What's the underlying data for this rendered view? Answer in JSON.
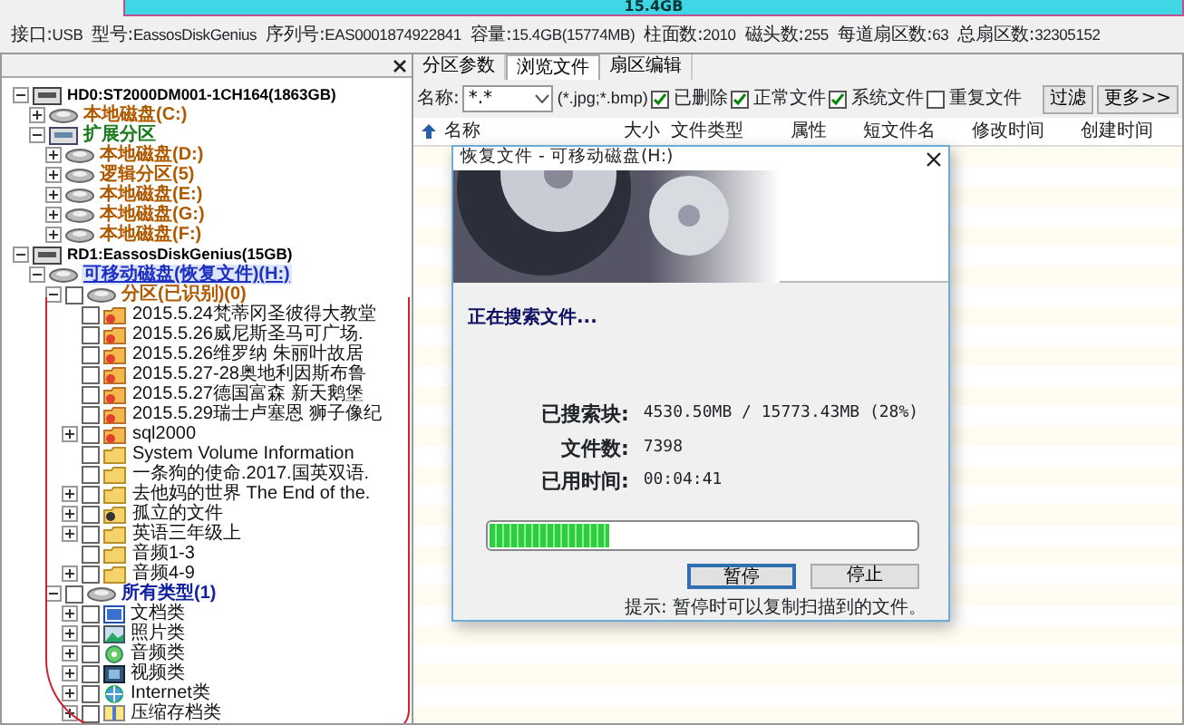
{
  "capacity_bar": {
    "label": "15.4GB"
  },
  "disk_info": [
    {
      "label": "接口:",
      "value": "USB"
    },
    {
      "label": "型号:",
      "value": "EassosDiskGenius"
    },
    {
      "label": "序列号:",
      "value": "EAS0001874922841"
    },
    {
      "label": "容量:",
      "value": "15.4GB(15774MB)"
    },
    {
      "label": "柱面数:",
      "value": "2010"
    },
    {
      "label": "磁头数:",
      "value": "255"
    },
    {
      "label": "每道扇区数:",
      "value": "63"
    },
    {
      "label": "总扇区数:",
      "value": "32305152"
    }
  ],
  "tree": [
    {
      "label": "HD0:ST2000DM001-1CH164(1863GB)",
      "kind": "drive",
      "expanded": true,
      "selected": false,
      "children": [
        {
          "label": "本地磁盘(C:)",
          "kind": "volume",
          "expanded": false,
          "selected": false
        },
        {
          "label": "扩展分区",
          "kind": "extended",
          "expanded": true,
          "selected": false,
          "children": [
            {
              "label": "本地磁盘(D:)",
              "kind": "volume",
              "expanded": false,
              "selected": false
            },
            {
              "label": "逻辑分区(5)",
              "kind": "volume",
              "expanded": false,
              "selected": false
            },
            {
              "label": "本地磁盘(E:)",
              "kind": "volume",
              "expanded": false,
              "selected": false
            },
            {
              "label": "本地磁盘(G:)",
              "kind": "volume",
              "expanded": false,
              "selected": false
            },
            {
              "label": "本地磁盘(F:)",
              "kind": "volume",
              "expanded": false,
              "selected": false
            }
          ]
        }
      ]
    },
    {
      "label": "RD1:EassosDiskGenius(15GB)",
      "kind": "drive",
      "expanded": true,
      "selected": false,
      "children": [
        {
          "label": "可移动磁盘(恢复文件)(H:)",
          "kind": "removable",
          "expanded": true,
          "selected": true,
          "children": [
            {
              "label": "分区(已识别)(0)",
              "kind": "partition",
              "expanded": true,
              "checked": false,
              "selected": false,
              "children": [
                {
                  "label": "2015.5.24梵蒂冈圣彼得大教堂",
                  "kind": "photo-folder",
                  "checked": false,
                  "selected": false
                },
                {
                  "label": "2015.5.26威尼斯圣马可广场.",
                  "kind": "photo-folder",
                  "checked": false,
                  "selected": false
                },
                {
                  "label": "2015.5.26维罗纳 朱丽叶故居",
                  "kind": "photo-folder",
                  "checked": false,
                  "selected": false
                },
                {
                  "label": "2015.5.27-28奥地利因斯布鲁",
                  "kind": "photo-folder",
                  "checked": false,
                  "selected": false
                },
                {
                  "label": "2015.5.27德国富森 新天鹅堡",
                  "kind": "photo-folder",
                  "checked": false,
                  "selected": false
                },
                {
                  "label": "2015.5.29瑞士卢塞恩 狮子像纪",
                  "kind": "photo-folder",
                  "checked": false,
                  "selected": false
                },
                {
                  "label": "sql2000",
                  "kind": "photo-folder",
                  "expanded": false,
                  "checked": false,
                  "selected": false
                },
                {
                  "label": "System Volume Information",
                  "kind": "folder",
                  "checked": false,
                  "selected": false
                },
                {
                  "label": "一条狗的使命.2017.国英双语.",
                  "kind": "folder",
                  "checked": false,
                  "selected": false
                },
                {
                  "label": "去他妈的世界 The End of the.",
                  "kind": "folder",
                  "expanded": false,
                  "checked": false,
                  "selected": false
                },
                {
                  "label": "孤立的文件",
                  "kind": "orphan",
                  "expanded": false,
                  "checked": false,
                  "selected": false
                },
                {
                  "label": "英语三年级上",
                  "kind": "folder",
                  "expanded": false,
                  "checked": false,
                  "selected": false
                },
                {
                  "label": "音频1-3",
                  "kind": "folder",
                  "checked": false,
                  "selected": false
                },
                {
                  "label": "音频4-9",
                  "kind": "folder",
                  "expanded": false,
                  "checked": false,
                  "selected": false
                }
              ]
            },
            {
              "label": "所有类型(1)",
              "kind": "types",
              "expanded": true,
              "checked": false,
              "selected": false,
              "children": [
                {
                  "label": "文档类",
                  "kind": "document",
                  "expanded": false,
                  "checked": false,
                  "selected": false
                },
                {
                  "label": "照片类",
                  "kind": "image",
                  "expanded": false,
                  "checked": false,
                  "selected": false
                },
                {
                  "label": "音频类",
                  "kind": "audio",
                  "expanded": false,
                  "checked": false,
                  "selected": false
                },
                {
                  "label": "视频类",
                  "kind": "video",
                  "expanded": false,
                  "checked": false,
                  "selected": false
                },
                {
                  "label": "Internet类",
                  "kind": "internet",
                  "expanded": false,
                  "checked": false,
                  "selected": false
                },
                {
                  "label": "压缩存档类",
                  "kind": "archive",
                  "expanded": false,
                  "checked": false,
                  "selected": false
                }
              ]
            }
          ]
        }
      ]
    }
  ],
  "tabs": [
    {
      "label": "分区参数",
      "selected": false
    },
    {
      "label": "浏览文件",
      "selected": true
    },
    {
      "label": "扇区编辑",
      "selected": false
    }
  ],
  "filter": {
    "name_label": "名称:",
    "name_value": "*.*",
    "hint": "(*.jpg;*.bmp)",
    "options": [
      {
        "label": "已删除",
        "checked": true
      },
      {
        "label": "正常文件",
        "checked": true
      },
      {
        "label": "系统文件",
        "checked": true
      },
      {
        "label": "重复文件",
        "checked": false
      }
    ],
    "buttons": [
      "过滤",
      "更多>>"
    ]
  },
  "columns": [
    "名称",
    "大小",
    "文件类型",
    "属性",
    "短文件名",
    "修改时间",
    "创建时间"
  ],
  "dialog": {
    "title": "恢复文件 - 可移动磁盘(H:)",
    "status": "正在搜索文件...",
    "stats": [
      {
        "label": "已搜索块:",
        "value": "4530.50MB / 15773.43MB (28%)"
      },
      {
        "label": "文件数:",
        "value": "7398"
      },
      {
        "label": "已用时间:",
        "value": "00:04:41"
      }
    ],
    "progress": {
      "level": 0.28
    },
    "buttons": [
      {
        "label": "暂停",
        "selected": true
      },
      {
        "label": "停止",
        "selected": false
      }
    ],
    "tip": "提示: 暂停时可以复制扫描到的文件。"
  }
}
